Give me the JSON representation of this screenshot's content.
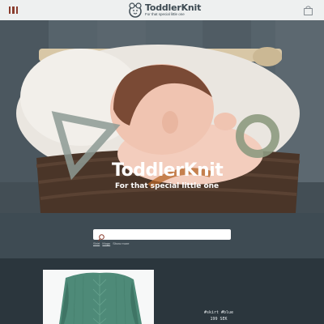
{
  "header": {
    "menu_icon": "menu-icon",
    "logo_title": "ToddlerKnit",
    "logo_subtitle": "For that special little one",
    "bag_icon": "shopping-bag-icon",
    "accent": "#8a3d2e"
  },
  "hero": {
    "title": "ToddlerKnit",
    "subtitle": "For that special little one"
  },
  "search": {
    "placeholder": "",
    "icon": "search-icon",
    "tags": [
      "Shirt",
      "Mugs",
      "Show more"
    ]
  },
  "products": {
    "items": [
      {
        "caption": "#skirt #blue",
        "price": "199 SEK"
      }
    ]
  },
  "colors": {
    "header_bg": "#eef0f0",
    "search_band": "#3e4b53",
    "page_bg": "#2b363d"
  }
}
